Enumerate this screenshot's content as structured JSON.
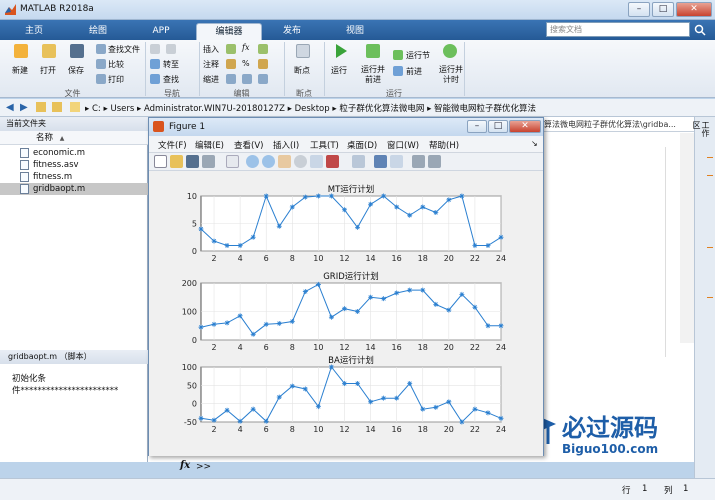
{
  "app": {
    "title": "MATLAB R2018a"
  },
  "tabs": [
    "主页",
    "绘图",
    "APP",
    "编辑器",
    "发布",
    "视图"
  ],
  "active_tab": "编辑器",
  "search": {
    "placeholder": "搜索文档"
  },
  "ribbon": {
    "new": "新建",
    "open": "打开",
    "save": "保存",
    "find_files": "查找文件",
    "compare": "比较",
    "print": "打印",
    "insert": "插入",
    "comment": "注释",
    "indent": "缩进",
    "goto": "转至",
    "find": "查找",
    "breakpoints": "断点",
    "run": "运行",
    "run_advance": "运行并\n前进",
    "run_section": "运行节",
    "advance": "前进",
    "run_time": "运行并\n计时",
    "groups": {
      "file": "文件",
      "navigate": "导航",
      "edit": "编辑",
      "breakpoints": "断点",
      "run": "运行"
    }
  },
  "address": {
    "parts": [
      "C:",
      "Users",
      "Administrator.WIN7U-20180127Z",
      "Desktop",
      "粒子群优化算法微电网",
      "智能微电网粒子群优化算法"
    ],
    "sep": "▸"
  },
  "current_folder": {
    "header": "当前文件夹",
    "column": "名称",
    "sort": "▲",
    "files": [
      "economic.m",
      "fitness.asv",
      "fitness.m",
      "gridbaopt.m"
    ],
    "selected": 3
  },
  "details": {
    "header": "gridbaopt.m （脚本）",
    "lines": [
      "初始化条",
      "件***********************"
    ]
  },
  "right_panel": {
    "path_text": "算法微电网粒子群优化算法\\gridba..."
  },
  "workspace_tab": "工作区",
  "command": {
    "fx": "fx",
    "prompt": ">>"
  },
  "status": {
    "row_label": "行",
    "row": "1",
    "col_label": "列",
    "col": "1"
  },
  "figure": {
    "title": "Figure 1",
    "menus": [
      "文件(F)",
      "编辑(E)",
      "查看(V)",
      "插入(I)",
      "工具(T)",
      "桌面(D)",
      "窗口(W)",
      "帮助(H)"
    ]
  },
  "watermark": {
    "cn": "必过源码",
    "en": "Biguo100.com"
  },
  "colors": {
    "accent": "#2a64a8",
    "plot_line": "#2a7fd0"
  },
  "chart_data": [
    {
      "type": "line",
      "title": "MT运行计划",
      "x": [
        1,
        2,
        3,
        4,
        5,
        6,
        7,
        8,
        9,
        10,
        11,
        12,
        13,
        14,
        15,
        16,
        17,
        18,
        19,
        20,
        21,
        22,
        23,
        24
      ],
      "values": [
        4,
        1.8,
        1,
        1,
        2.5,
        10,
        4.5,
        8,
        9.8,
        10,
        10,
        7.5,
        4.3,
        8.5,
        10,
        8,
        6.5,
        8,
        7,
        9.3,
        10,
        1,
        1,
        2.5,
        2
      ],
      "ylim": [
        0,
        10
      ],
      "yticks": [
        0,
        5,
        10
      ],
      "xticks": [
        2,
        4,
        6,
        8,
        10,
        12,
        14,
        16,
        18,
        20,
        22,
        24
      ]
    },
    {
      "type": "line",
      "title": "GRID运行计划",
      "x": [
        1,
        2,
        3,
        4,
        5,
        6,
        7,
        8,
        9,
        10,
        11,
        12,
        13,
        14,
        15,
        16,
        17,
        18,
        19,
        20,
        21,
        22,
        23,
        24
      ],
      "values": [
        45,
        55,
        60,
        85,
        20,
        55,
        58,
        65,
        170,
        195,
        80,
        110,
        100,
        150,
        145,
        165,
        175,
        175,
        125,
        105,
        160,
        115,
        50,
        50
      ],
      "ylim": [
        0,
        200
      ],
      "yticks": [
        0,
        100,
        200
      ],
      "xticks": [
        2,
        4,
        6,
        8,
        10,
        12,
        14,
        16,
        18,
        20,
        22,
        24
      ]
    },
    {
      "type": "line",
      "title": "BA运行计划",
      "x": [
        1,
        2,
        3,
        4,
        5,
        6,
        7,
        8,
        9,
        10,
        11,
        12,
        13,
        14,
        15,
        16,
        17,
        18,
        19,
        20,
        21,
        22,
        23,
        24
      ],
      "values": [
        -40,
        -45,
        -18,
        -48,
        -15,
        -48,
        18,
        48,
        40,
        -8,
        100,
        55,
        55,
        5,
        15,
        15,
        55,
        -15,
        -10,
        5,
        -50,
        -15,
        -25,
        -40
      ],
      "ylim": [
        -50,
        100
      ],
      "yticks": [
        -50,
        0,
        50,
        100
      ],
      "xticks": [
        2,
        4,
        6,
        8,
        10,
        12,
        14,
        16,
        18,
        20,
        22,
        24
      ]
    }
  ]
}
